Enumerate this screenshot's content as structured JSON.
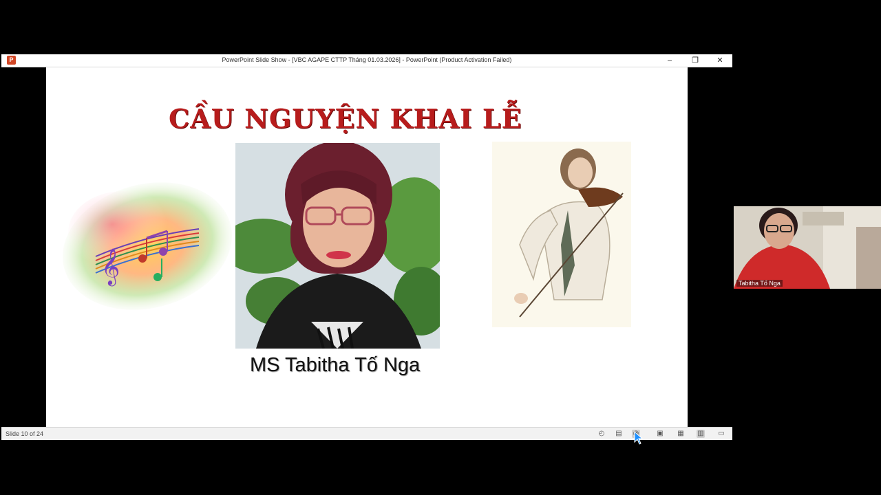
{
  "window": {
    "title": "PowerPoint Slide Show - [VBC AGAPE CTTP Tháng 01.03.2026] - PowerPoint (Product Activation Failed)",
    "app_icon": "P",
    "minimize_icon": "–",
    "restore_icon": "❐",
    "close_icon": "✕"
  },
  "slide": {
    "title": "CẦU NGUYỆN KHAI LỄ",
    "caption": "MS Tabitha Tố Nga",
    "title_color": "#b71c1c"
  },
  "statusbar": {
    "slide_counter": "Slide 10 of 24",
    "icons": [
      "accessibility-icon",
      "notes-icon",
      "presenter-icon",
      "normal-view-icon",
      "slide-sorter-icon",
      "reading-view-icon",
      "slideshow-icon"
    ]
  },
  "video": {
    "participant_name": "Tabitha Tố Nga"
  }
}
